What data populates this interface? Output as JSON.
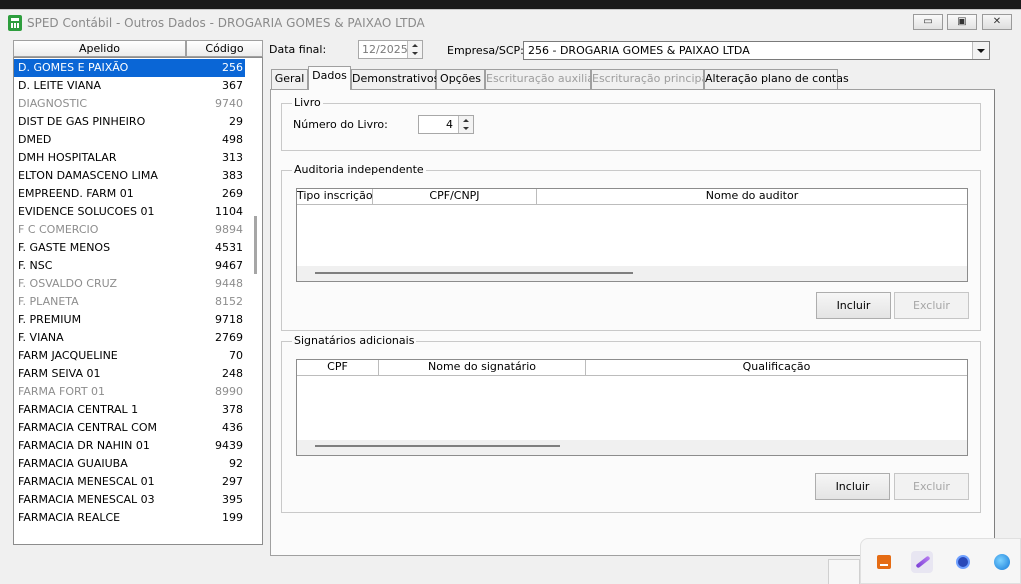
{
  "window": {
    "title": "SPED Contábil - Outros Dados - DROGARIA GOMES & PAIXAO LTDA",
    "minimize_glyph": "▭",
    "maximize_glyph": "▣",
    "close_glyph": "✕"
  },
  "list": {
    "col_apelido": "Apelido",
    "col_codigo": "Código",
    "rows": [
      {
        "name": "D. GOMES E PAIXÃO",
        "code": "256",
        "state": "selected"
      },
      {
        "name": "D. LEITE VIANA",
        "code": "367",
        "state": "normal"
      },
      {
        "name": "DIAGNOSTIC",
        "code": "9740",
        "state": "disabled"
      },
      {
        "name": "DIST DE GAS PINHEIRO",
        "code": "29",
        "state": "normal"
      },
      {
        "name": "DMED",
        "code": "498",
        "state": "normal"
      },
      {
        "name": "DMH HOSPITALAR",
        "code": "313",
        "state": "normal"
      },
      {
        "name": "ELTON DAMASCENO LIMA",
        "code": "383",
        "state": "normal"
      },
      {
        "name": "EMPREEND. FARM 01",
        "code": "269",
        "state": "normal"
      },
      {
        "name": "EVIDENCE SOLUCOES 01",
        "code": "1104",
        "state": "normal"
      },
      {
        "name": "F C COMERCIO",
        "code": "9894",
        "state": "disabled"
      },
      {
        "name": "F. GASTE MENOS",
        "code": "4531",
        "state": "normal"
      },
      {
        "name": "F. NSC",
        "code": "9467",
        "state": "normal"
      },
      {
        "name": "F. OSVALDO CRUZ",
        "code": "9448",
        "state": "disabled"
      },
      {
        "name": "F. PLANETA",
        "code": "8152",
        "state": "disabled"
      },
      {
        "name": "F. PREMIUM",
        "code": "9718",
        "state": "normal"
      },
      {
        "name": "F. VIANA",
        "code": "2769",
        "state": "normal"
      },
      {
        "name": "FARM JACQUELINE",
        "code": "70",
        "state": "normal"
      },
      {
        "name": "FARM SEIVA 01",
        "code": "248",
        "state": "normal"
      },
      {
        "name": "FARMA FORT 01",
        "code": "8990",
        "state": "disabled"
      },
      {
        "name": "FARMACIA CENTRAL 1",
        "code": "378",
        "state": "normal"
      },
      {
        "name": "FARMACIA CENTRAL COM",
        "code": "436",
        "state": "normal"
      },
      {
        "name": "FARMACIA DR NAHIN 01",
        "code": "9439",
        "state": "normal"
      },
      {
        "name": "FARMACIA GUAIUBA",
        "code": "92",
        "state": "normal"
      },
      {
        "name": "FARMACIA MENESCAL 01",
        "code": "297",
        "state": "normal"
      },
      {
        "name": "FARMACIA MENESCAL 03",
        "code": "395",
        "state": "normal"
      },
      {
        "name": "FARMACIA REALCE",
        "code": "199",
        "state": "normal"
      }
    ]
  },
  "form": {
    "data_final_label": "Data final:",
    "data_final_value": "12/2025",
    "empresa_label": "Empresa/SCP:",
    "empresa_value": "256 - DROGARIA GOMES & PAIXAO LTDA"
  },
  "tabs": [
    {
      "label": "Geral",
      "state": "normal"
    },
    {
      "label": "Dados",
      "state": "active"
    },
    {
      "label": "Demonstrativos",
      "state": "normal"
    },
    {
      "label": "Opções",
      "state": "normal"
    },
    {
      "label": "Escrituração auxiliar",
      "state": "disabled"
    },
    {
      "label": "Escrituração principal",
      "state": "disabled"
    },
    {
      "label": "Alteração plano de contas",
      "state": "normal"
    }
  ],
  "livro": {
    "group_label": "Livro",
    "numero_label": "Número do  Livro:",
    "numero_value": "4"
  },
  "auditoria": {
    "group_label": "Auditoria independente",
    "columns": [
      "Tipo inscrição",
      "CPF/CNPJ",
      "Nome do auditor"
    ],
    "incluir_label": "Incluir",
    "excluir_label": "Excluir"
  },
  "signatarios": {
    "group_label": "Signatários adicionais",
    "columns": [
      "CPF",
      "Nome do signatário",
      "Qualificação"
    ],
    "incluir_label": "Incluir",
    "excluir_label": "Excluir"
  },
  "tray": {
    "icons": [
      "java-icon",
      "pen-icon",
      "circle-app-icon",
      "globe-icon"
    ]
  }
}
